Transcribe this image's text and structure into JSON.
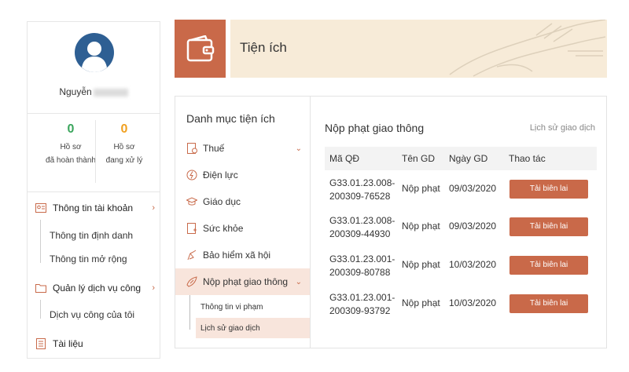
{
  "profile": {
    "name": "Nguyễn",
    "stats": [
      {
        "value": "0",
        "label_line1": "Hồ sơ",
        "label_line2": "đã hoàn thành",
        "color": "#3aa55c"
      },
      {
        "value": "0",
        "label_line1": "Hồ sơ",
        "label_line2": "đang xử lý",
        "color": "#f0a020"
      }
    ]
  },
  "sidebar": {
    "account": {
      "label": "Thông tin tài khoản",
      "subitems": [
        "Thông tin định danh",
        "Thông tin mở rộng"
      ]
    },
    "services": {
      "label": "Quản lý dịch vụ công",
      "subitems": [
        "Dịch vụ công của tôi"
      ]
    },
    "documents": {
      "label": "Tài liệu"
    }
  },
  "header": {
    "title": "Tiện ích"
  },
  "category": {
    "title": "Danh mục tiện ích",
    "items": [
      {
        "label": "Thuế",
        "icon": "tax-document-icon"
      },
      {
        "label": "Điện lực",
        "icon": "electricity-icon"
      },
      {
        "label": "Giáo dục",
        "icon": "graduation-cap-icon"
      },
      {
        "label": "Sức khỏe",
        "icon": "health-record-icon"
      },
      {
        "label": "Bảo hiểm xã hội",
        "icon": "social-insurance-icon"
      },
      {
        "label": "Nộp phạt giao thông",
        "icon": "traffic-fine-icon"
      }
    ],
    "subitems": [
      "Thông tin vi phạm",
      "Lịch sử giao dịch"
    ]
  },
  "content": {
    "title": "Nộp phạt giao thông",
    "history_link": "Lịch sử giao dịch",
    "columns": [
      "Mã QĐ",
      "Tên GD",
      "Ngày GD",
      "Thao tác"
    ],
    "rows": [
      {
        "id_line1": "G33.01.23.008-",
        "id_line2": "200309-76528",
        "name": "Nộp phạt",
        "date": "09/03/2020",
        "action": "Tải biên lai"
      },
      {
        "id_line1": "G33.01.23.008-",
        "id_line2": "200309-44930",
        "name": "Nộp phạt",
        "date": "09/03/2020",
        "action": "Tải biên lai"
      },
      {
        "id_line1": "G33.01.23.001-",
        "id_line2": "200309-80788",
        "name": "Nộp phạt",
        "date": "10/03/2020",
        "action": "Tải biên lai"
      },
      {
        "id_line1": "G33.01.23.001-",
        "id_line2": "200309-93792",
        "name": "Nộp phạt",
        "date": "10/03/2020",
        "action": "Tải biên lai"
      }
    ]
  },
  "colors": {
    "accent": "#c96949",
    "banner": "#f7ebd8",
    "active_bg": "#f8e5dc",
    "avatar": "#2e5f93"
  }
}
